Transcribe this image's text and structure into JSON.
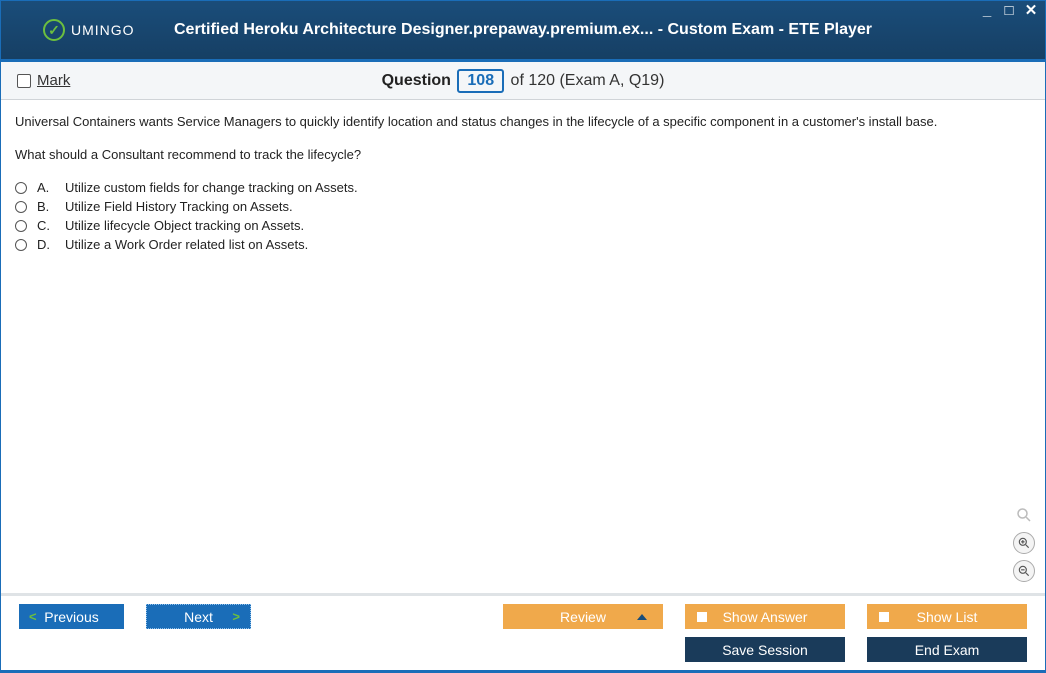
{
  "window": {
    "title": "Certified Heroku Architecture Designer.prepaway.premium.ex... - Custom Exam - ETE Player",
    "logo_text": "UMINGO"
  },
  "toolbar": {
    "mark_label": "Mark",
    "question_word": "Question",
    "question_num": "108",
    "of_text": " of 120 (Exam A, Q19)"
  },
  "question": {
    "line1": "Universal Containers wants Service Managers to quickly identify location and status changes in the lifecycle of a specific component in a customer's install base.",
    "line2": "What should a Consultant recommend to track the lifecycle?"
  },
  "answers": [
    {
      "letter": "A.",
      "text": "Utilize custom fields for change tracking on Assets."
    },
    {
      "letter": "B.",
      "text": "Utilize Field History Tracking on Assets."
    },
    {
      "letter": "C.",
      "text": "Utilize lifecycle Object tracking on Assets."
    },
    {
      "letter": "D.",
      "text": "Utilize a Work Order related list on Assets."
    }
  ],
  "footer": {
    "previous": "Previous",
    "next": "Next",
    "review": "Review",
    "show_answer": "Show Answer",
    "show_list": "Show List",
    "save_session": "Save Session",
    "end_exam": "End Exam"
  }
}
